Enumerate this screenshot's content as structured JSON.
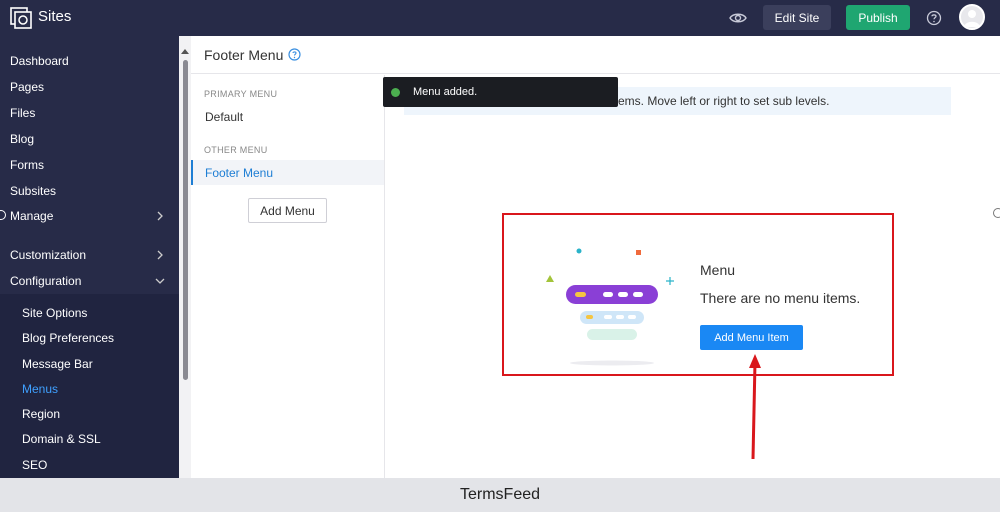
{
  "app": {
    "title": "Sites"
  },
  "topbar": {
    "preview_icon": "eye-icon",
    "edit_site_label": "Edit Site",
    "publish_label": "Publish",
    "help_icon": "question-circle-icon"
  },
  "sidebar": {
    "items": [
      {
        "label": "Dashboard"
      },
      {
        "label": "Pages"
      },
      {
        "label": "Files"
      },
      {
        "label": "Blog"
      },
      {
        "label": "Forms"
      },
      {
        "label": "Subsites"
      },
      {
        "label": "Manage"
      },
      {
        "label": "Customization"
      },
      {
        "label": "Configuration"
      }
    ],
    "config_subitems": [
      {
        "label": "Site Options"
      },
      {
        "label": "Blog Preferences"
      },
      {
        "label": "Message Bar"
      },
      {
        "label": "Menus",
        "active": true
      },
      {
        "label": "Region"
      },
      {
        "label": "Domain & SSL"
      },
      {
        "label": "SEO"
      }
    ]
  },
  "content": {
    "title": "Footer Menu",
    "primary_menu_label": "PRIMARY MENU",
    "primary_menus": [
      "Default"
    ],
    "other_menu_label": "OTHER MENU",
    "other_menus": [
      "Footer Menu"
    ],
    "add_menu_label": "Add Menu",
    "info_text": "ems. Move left or right to set sub levels.",
    "toast_text": "Menu added.",
    "empty_state": {
      "title": "Menu",
      "message": "There are no menu items.",
      "button_label": "Add Menu Item"
    }
  },
  "footer": {
    "text": "TermsFeed"
  },
  "colors": {
    "topbar_bg": "#272b48",
    "publish": "#1fa671",
    "accent": "#1a88f4",
    "highlight": "#d9171c",
    "active_link": "#3fa0ff"
  }
}
